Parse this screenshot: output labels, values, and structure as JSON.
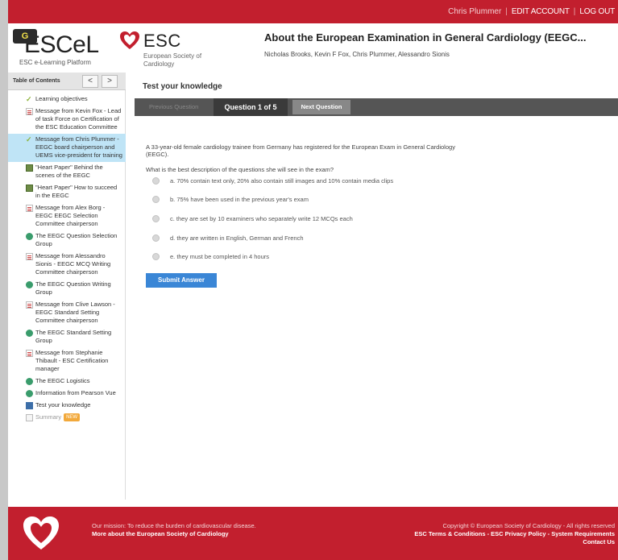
{
  "topbar": {
    "user_name": "Chris Plummer",
    "edit_account": "EDIT ACCOUNT",
    "logout": "LOG OUT"
  },
  "header": {
    "escel_logo": "ESCeL",
    "escel_sub": "ESC e-Learning Platform",
    "g_badge": "G",
    "esc_logo": "ESC",
    "esc_sub": "European Society of Cardiology",
    "course_title": "About the European Examination in General Cardiology (EEGC...",
    "authors": "Nicholas Brooks, Kevin F Fox, Chris Plummer, Alessandro Sionis"
  },
  "toc": {
    "title": "Table of Contents",
    "prev": "<",
    "next": ">",
    "items": [
      {
        "label": "Learning objectives",
        "icon": "check-icon"
      },
      {
        "label": "Message from Kevin Fox - Lead of task Force on Certification of the ESC Education Committee",
        "icon": "document-icon"
      },
      {
        "label": "Message from Chris Plummer - EEGC board chairperson and UEMS vice-president for training",
        "icon": "check-icon"
      },
      {
        "label": "\"Heart Paper\" Behind the scenes of the EEGC",
        "icon": "image-icon"
      },
      {
        "label": "\"Heart Paper\" How to succeed in the EEGC",
        "icon": "image-icon"
      },
      {
        "label": "Message from Alex Borg - EEGC EEGC Selection Committee chairperson",
        "icon": "document-icon"
      },
      {
        "label": "The EEGC Question Selection Group",
        "icon": "globe-icon"
      },
      {
        "label": "Message from Alessandro Sionis - EEGC MCQ Writing Committee chairperson",
        "icon": "document-icon"
      },
      {
        "label": "The EEGC Question Writing Group",
        "icon": "globe-icon"
      },
      {
        "label": "Message from Clive Lawson - EEGC Standard Setting Committee chairperson",
        "icon": "document-icon"
      },
      {
        "label": "The EEGC Standard Setting Group",
        "icon": "globe-icon"
      },
      {
        "label": "Message from Stephanie Thibault - ESC Certification manager",
        "icon": "document-icon"
      },
      {
        "label": "The EEGC Logistics",
        "icon": "globe-icon"
      },
      {
        "label": "Information from Pearson Vue",
        "icon": "globe-icon"
      },
      {
        "label": "Test your knowledge",
        "icon": "quiz-icon"
      },
      {
        "label": "Summary",
        "icon": "summary-icon",
        "badge": "NEW"
      }
    ]
  },
  "content": {
    "title": "Test your knowledge",
    "prev_question": "Previous Question",
    "counter": "Question 1 of 5",
    "next_question": "Next Question",
    "intro": "A 33-year-old female cardiology trainee from Germany has registered for the European Exam in General Cardiology (EEGC).",
    "question": "What is the best description of the questions she will see in the exam?",
    "options": [
      "a. 70% contain text only, 20% also contain still images and 10% contain media clips",
      "b. 75% have been used in the previous year's exam",
      "c. they are set by 10 examiners who separately write 12 MCQs each",
      "d. they are written in English, German and French",
      "e. they must be completed in 4 hours"
    ],
    "submit": "Submit Answer"
  },
  "footer": {
    "mission": "Our mission: To reduce the burden of cardiovascular disease.",
    "more_about": "More about the European Society of Cardiology",
    "copyright": "Copyright © European Society of Cardiology - All rights reserved",
    "links": "ESC Terms & Conditions - ESC Privacy Policy - System Requirements",
    "contact": "Contact Us"
  },
  "colors": {
    "brand_red": "#c21f2e",
    "submit_blue": "#3a86d6",
    "active_item": "#bfe4f6"
  }
}
